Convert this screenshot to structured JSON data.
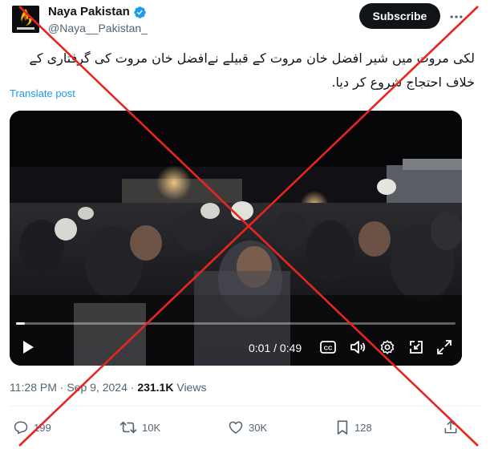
{
  "author": {
    "name": "Naya Pakistan",
    "handle": "@Naya__Pakistan_",
    "avatar_icon": "naya-pakistan-logo",
    "verified_icon": "verified-badge-icon",
    "verified_color": "#1d9bf0"
  },
  "header": {
    "subscribe_label": "Subscribe",
    "more_icon": "more-options-icon"
  },
  "post": {
    "text": "لکی مروت میں شیر افضل خان مروت کے قبیلے نےافضل خان مروت کی گرفتاری کے خلاف احتجاج شروع کر دیا.",
    "translate_label": "Translate post"
  },
  "video": {
    "timecode": "0:01 / 0:49",
    "progress": 0.02,
    "controls": [
      "play-icon",
      "captions-icon",
      "volume-icon",
      "settings-icon",
      "minimize-icon",
      "fullscreen-icon"
    ]
  },
  "meta": {
    "time": "11:28 PM",
    "separator": " · ",
    "date": "Sep 9, 2024",
    "views_count": "231.1K",
    "views_label": " Views"
  },
  "actions": {
    "replies": "199",
    "reposts": "10K",
    "likes": "30K",
    "bookmarks": "128"
  },
  "colors": {
    "text": "#0f1419",
    "secondary": "#536471",
    "link": "#1d9bf0",
    "overlay_x": "#e8261f"
  }
}
